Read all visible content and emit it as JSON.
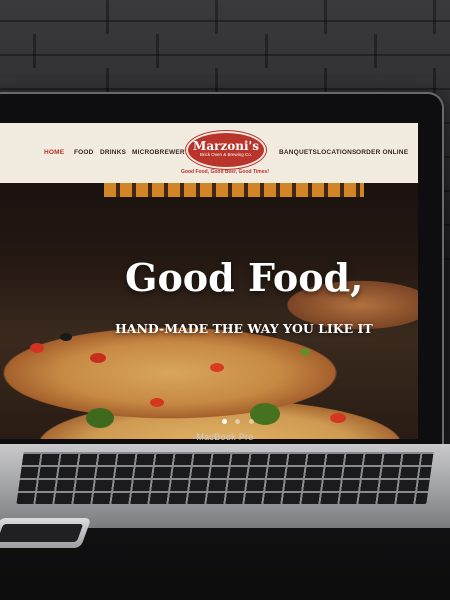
{
  "nav": {
    "left": [
      "HOME",
      "FOOD",
      "DRINKS",
      "MICROBREWERY"
    ],
    "right": [
      "BANQUETS",
      "LOCATIONS",
      "ORDER ONLINE"
    ],
    "active": "HOME"
  },
  "logo": {
    "name": "Marzoni's",
    "sub": "Brick Oven & Brewing Co.",
    "tagline": "Good Food, Good Beer, Good Times!"
  },
  "hero": {
    "headline": "Good Food,",
    "subline": "HAND-MADE THE WAY YOU LIKE IT",
    "slides": 3,
    "active_slide": 1
  },
  "device": {
    "label": "MacBook Pro"
  },
  "colors": {
    "accent": "#b8342c",
    "nav_bg": "#f1ebe0"
  }
}
